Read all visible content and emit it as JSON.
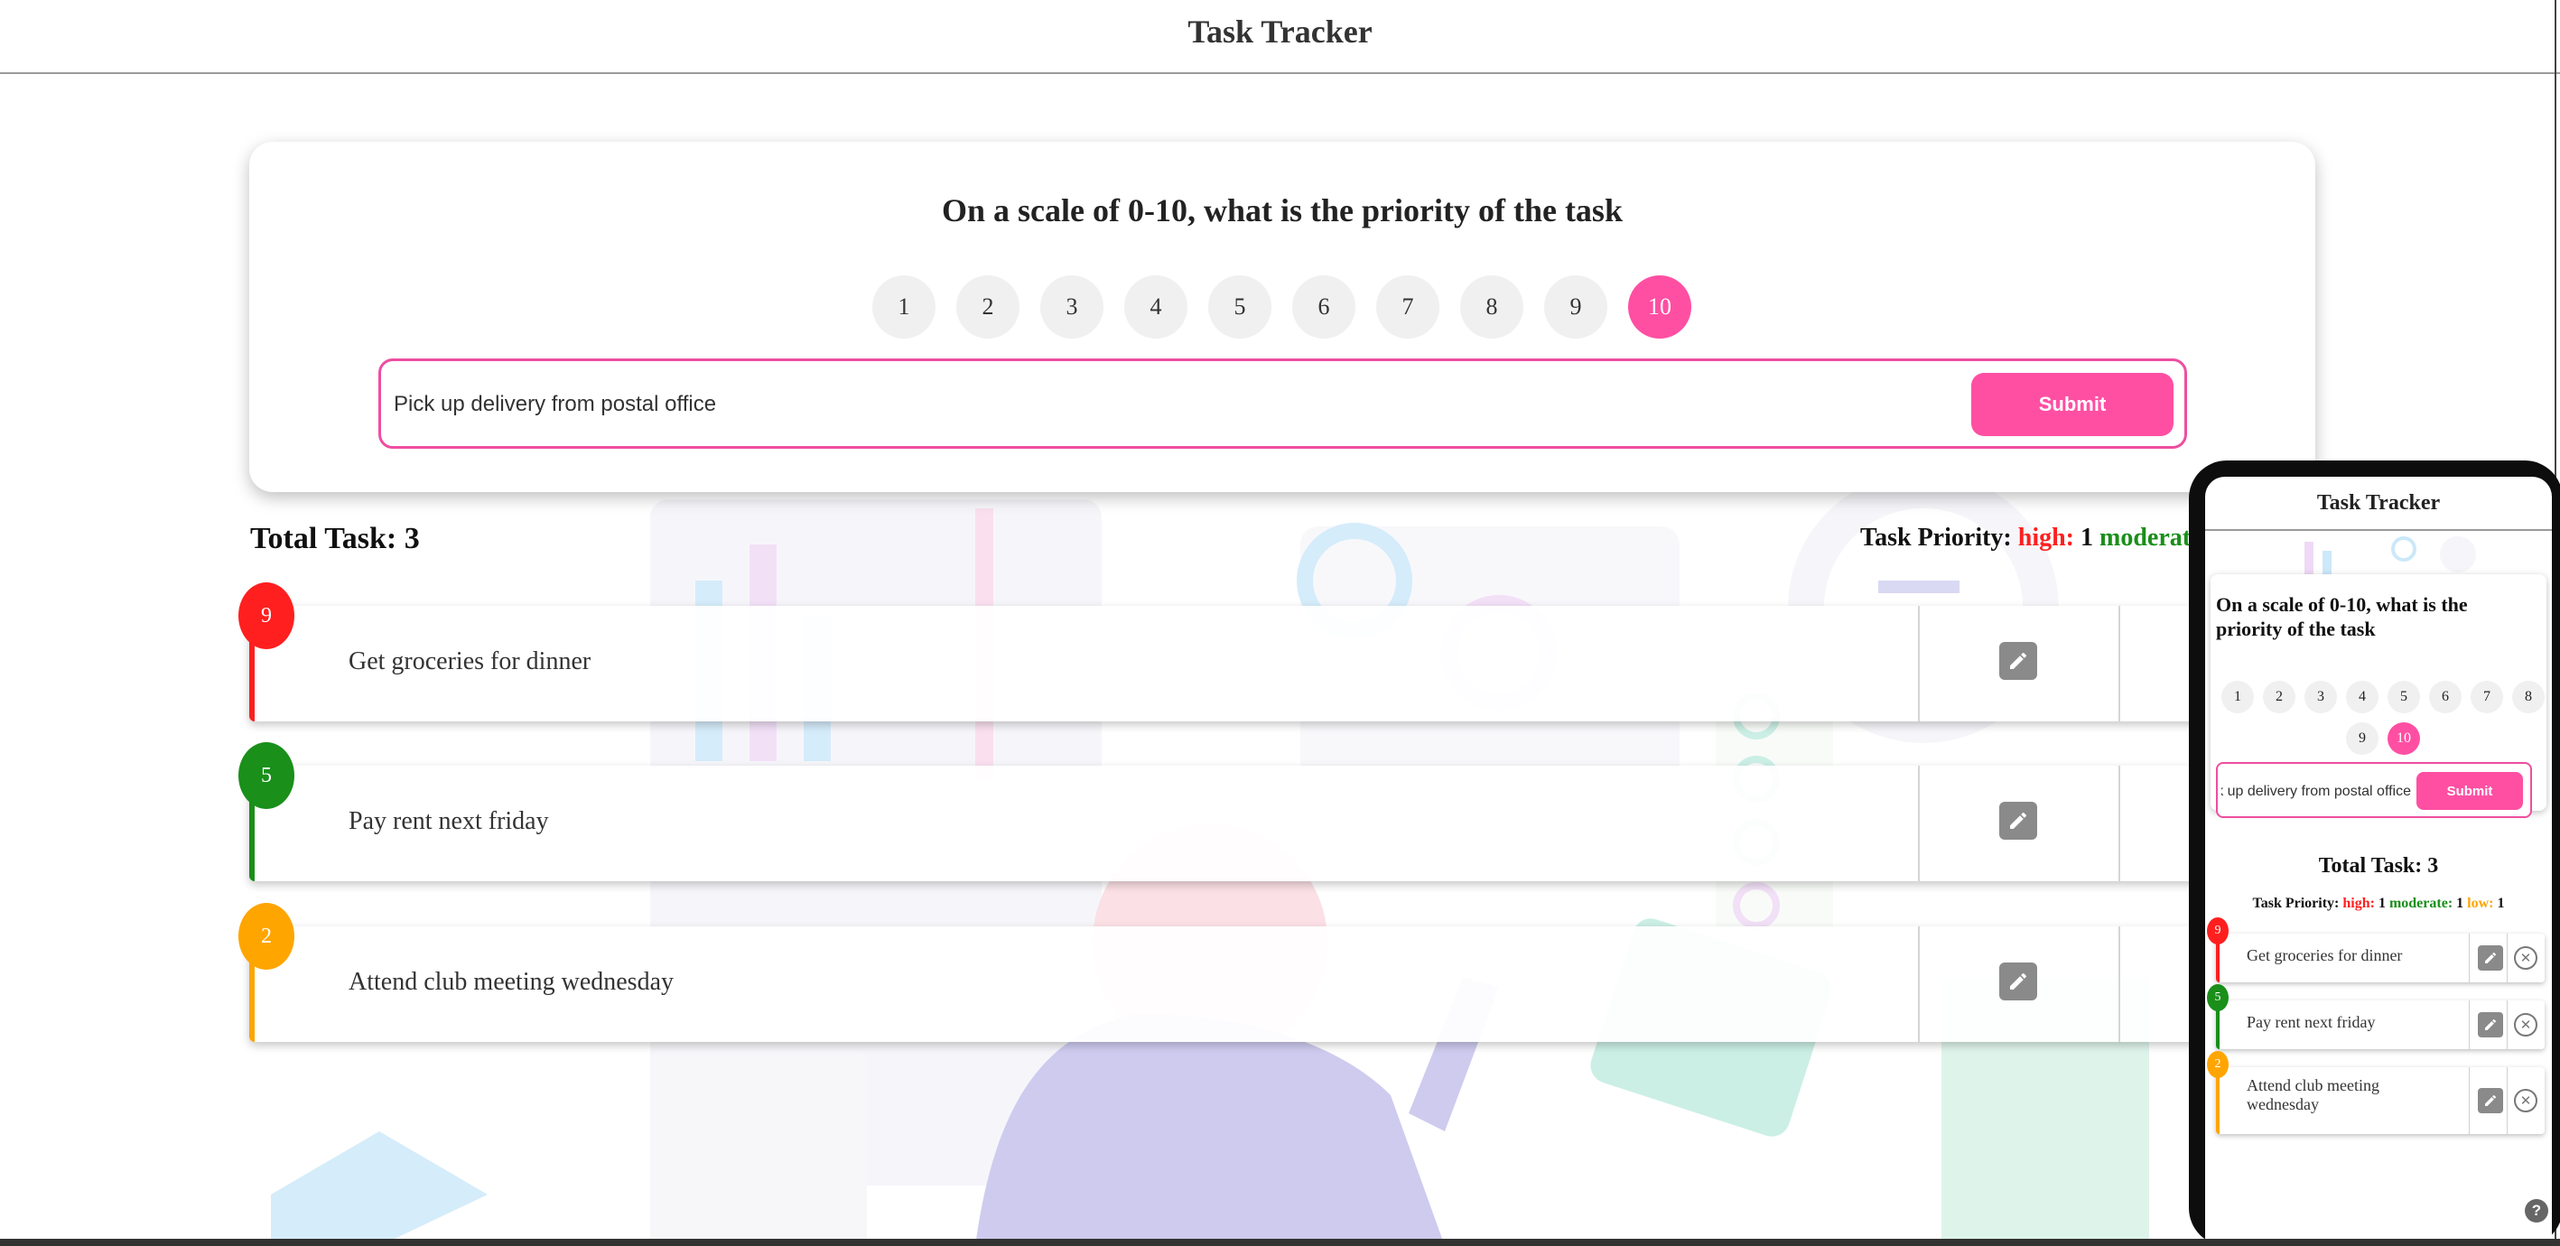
{
  "app": {
    "title": "Task Tracker"
  },
  "priority_card": {
    "question": "On a scale of 0-10, what is the priority of the task",
    "scale": [
      "1",
      "2",
      "3",
      "4",
      "5",
      "6",
      "7",
      "8",
      "9",
      "10"
    ],
    "selected": "10",
    "input_value": "Pick up delivery from postal office",
    "submit_label": "Submit"
  },
  "stats": {
    "total_label": "Total Task: 3",
    "priority_label": "Task Priority:",
    "high_label": "high:",
    "high_count": "1",
    "moderate_label": "moderate:",
    "moderate_count": "1",
    "low_label": "low:",
    "low_count": "1"
  },
  "tasks": [
    {
      "priority": "9",
      "text": "Get groceries for dinner",
      "level": "high",
      "color": "#ff1f1f"
    },
    {
      "priority": "5",
      "text": "Pay rent next friday",
      "level": "moderate",
      "color": "#1a8f1a"
    },
    {
      "priority": "2",
      "text": "Attend club meeting wednesday",
      "level": "low",
      "color": "#ffa500"
    }
  ],
  "mobile": {
    "title": "Task Tracker",
    "question": "On a scale of 0-10, what is the priority of the task",
    "input_value": "Pick up delivery from postal office",
    "submit_label": "Submit",
    "total_label": "Total Task: 3",
    "help_label": "?",
    "tasks": [
      {
        "priority": "9",
        "text": "Get groceries for dinner"
      },
      {
        "priority": "5",
        "text": "Pay rent next friday"
      },
      {
        "priority": "2",
        "text": "Attend club meeting wednesday"
      }
    ]
  },
  "colors": {
    "accent": "#ff4fa3",
    "high": "#ff1f1f",
    "moderate": "#1a8f1a",
    "low": "#ffa500",
    "edit_icon_bg": "#8a8a8a"
  },
  "icons": {
    "edit": "pencil-icon",
    "delete": "close-circle-icon",
    "help": "help-icon"
  }
}
